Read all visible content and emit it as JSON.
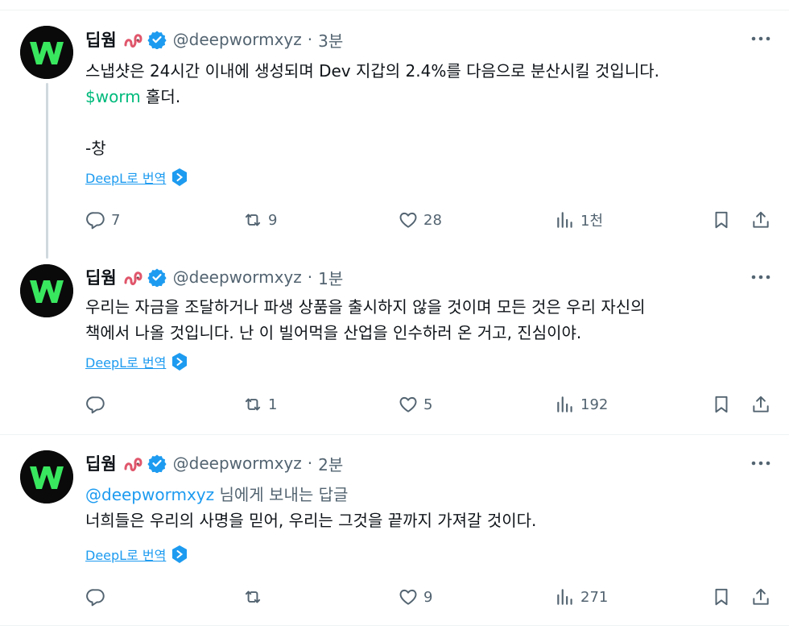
{
  "tweets": [
    {
      "name": "딥웜",
      "handle": "@deepwormxyz",
      "dot": "·",
      "time": "3분",
      "lines": [
        "스냅샷은 24시간 이내에 생성되며 Dev 지갑의 2.4%를 다음으로 분산시킬 것입니다.",
        "홀더.",
        "-창"
      ],
      "cashtag": "$worm",
      "deepl_label": "DeepL로 번역",
      "replies": "7",
      "retweets": "9",
      "likes": "28",
      "views": "1천"
    },
    {
      "name": "딥웜",
      "handle": "@deepwormxyz",
      "dot": "·",
      "time": "1분",
      "lines": [
        "우리는 자금을 조달하거나 파생 상품을 출시하지 않을 것이며 모든 것은 우리 자신의",
        "책에서 나올 것입니다. 난 이 빌어먹을 산업을 인수하러 온 거고, 진심이야."
      ],
      "deepl_label": "DeepL로 번역",
      "replies": "",
      "retweets": "1",
      "likes": "5",
      "views": "192"
    },
    {
      "name": "딥웜",
      "handle": "@deepwormxyz",
      "dot": "·",
      "time": "2분",
      "reply_to_mention": "@deepwormxyz",
      "reply_to_suffix": " 님에게 보내는 답글",
      "lines": [
        "너희들은 우리의 사명을 믿어, 우리는 그것을 끝까지 가져갈 것이다."
      ],
      "deepl_label": "DeepL로 번역",
      "replies": "",
      "retweets": "",
      "likes": "9",
      "views": "271"
    }
  ],
  "colors": {
    "accent": "#1d9bf0",
    "cashtag": "#00ba7c",
    "secondary_text": "#536471",
    "avatar_logo": "#39e75f"
  },
  "icons": [
    "more-icon",
    "verified-badge-icon",
    "worm-emoji-icon",
    "deepl-icon",
    "reply-icon",
    "retweet-icon",
    "like-icon",
    "views-icon",
    "bookmark-icon",
    "share-icon"
  ]
}
